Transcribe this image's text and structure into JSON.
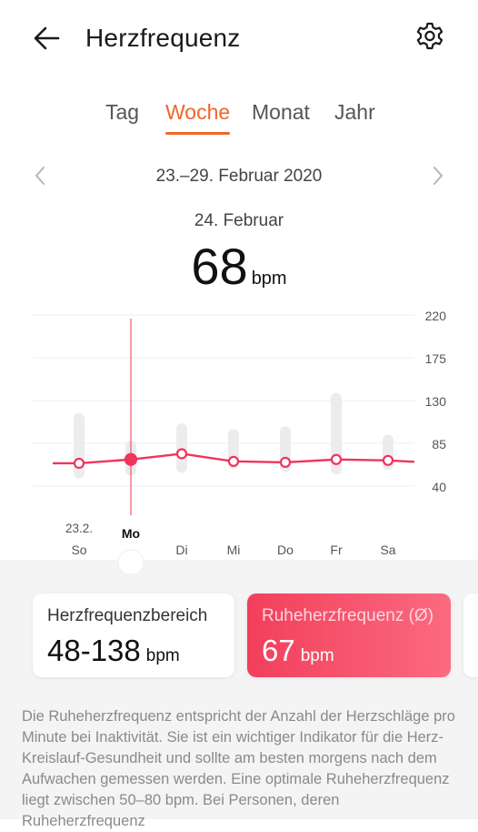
{
  "header": {
    "title": "Herzfrequenz",
    "back_icon": "arrow-left-icon",
    "settings_icon": "gear-icon"
  },
  "tabs": [
    {
      "label": "Tag",
      "active": false
    },
    {
      "label": "Woche",
      "active": true
    },
    {
      "label": "Monat",
      "active": false
    },
    {
      "label": "Jahr",
      "active": false
    }
  ],
  "date_nav": {
    "range": "23.–29. Februar 2020",
    "prev_icon": "chevron-left-icon",
    "next_icon": "chevron-right-icon"
  },
  "selection": {
    "date": "24. Februar",
    "value": "68",
    "unit": "bpm"
  },
  "chart_data": {
    "type": "line",
    "y_ticks": [
      "220",
      "175",
      "130",
      "85",
      "40"
    ],
    "ylim": [
      40,
      220
    ],
    "x_categories": [
      "So",
      "Mo",
      "Di",
      "Mi",
      "Do",
      "Fr",
      "Sa"
    ],
    "first_date_label": "23.2.",
    "selected_index": 1,
    "series": [
      {
        "values": [
          64,
          68,
          74,
          66,
          65,
          68,
          67
        ]
      }
    ],
    "ranges": [
      [
        48,
        117
      ],
      [
        51,
        88
      ],
      [
        54,
        106
      ],
      [
        58,
        100
      ],
      [
        55,
        103
      ],
      [
        52,
        138
      ],
      [
        57,
        94
      ]
    ],
    "colors": {
      "line": "#f0345a",
      "range_bar": "#ececec"
    }
  },
  "cards": {
    "range": {
      "label": "Herzfrequenzbereich",
      "value": "48-138",
      "unit": "bpm"
    },
    "resting": {
      "label": "Ruheherzfrequenz (Ø)",
      "value": "67",
      "unit": "bpm"
    }
  },
  "description": "Die Ruheherzfrequenz entspricht der Anzahl der Herz­schläge pro Minute bei Inaktivität. Sie ist ein wichtiger Indikator für die Herz-Kreislauf-Gesundheit und sollte am besten morgens nach dem Aufwachen gemessen werden. Eine optimale Ruheherzfrequenz liegt zwischen 50–80 bpm. Bei Personen, deren Ruheherzfrequenz"
}
